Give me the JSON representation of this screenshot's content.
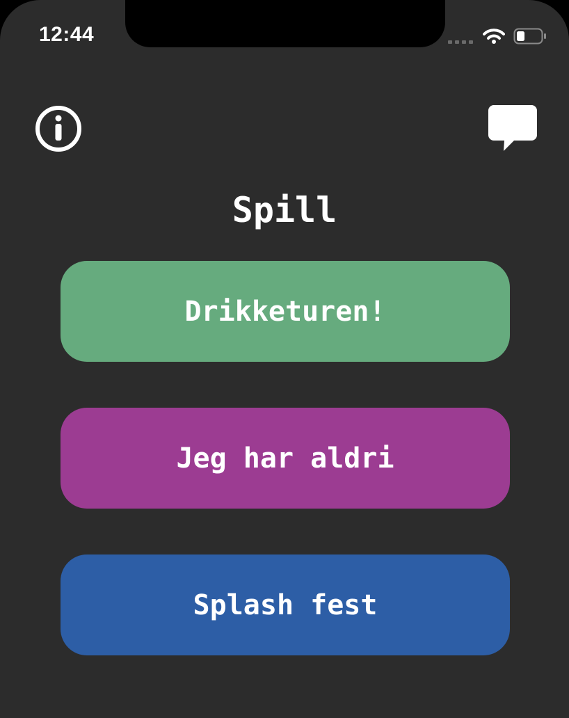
{
  "status_bar": {
    "time": "12:44"
  },
  "header": {
    "title": "Spill",
    "info_icon": "info-circle-icon",
    "chat_icon": "speech-bubble-icon"
  },
  "games": [
    {
      "label": "Drikketuren!",
      "color": "#66ab7e"
    },
    {
      "label": "Jeg har aldri",
      "color": "#9c3c92"
    },
    {
      "label": "Splash fest",
      "color": "#2d5ea6"
    }
  ],
  "colors": {
    "background": "#2c2c2c",
    "text": "#ffffff"
  }
}
